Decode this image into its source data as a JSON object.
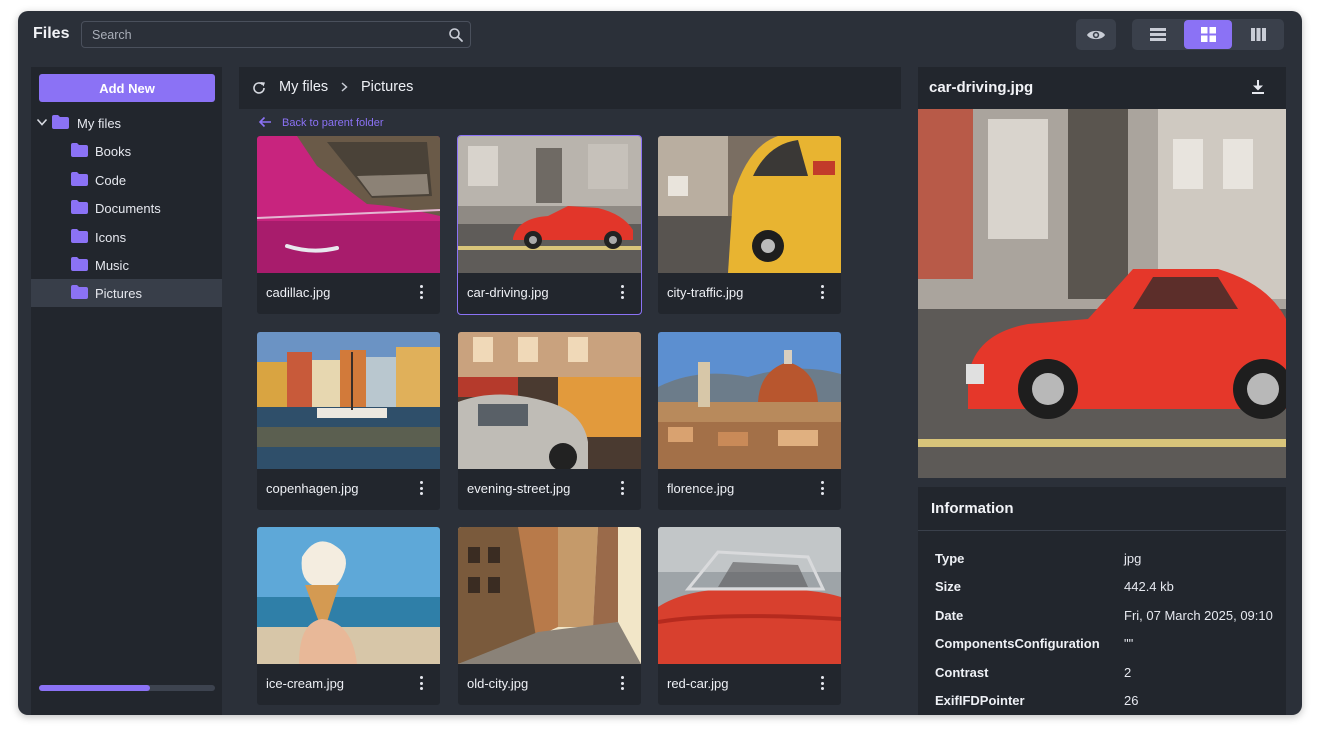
{
  "app": {
    "title": "Files"
  },
  "search": {
    "placeholder": "Search"
  },
  "toolbar": {
    "preview_toggle_icon": "eye-icon",
    "views": [
      {
        "name": "list",
        "icon": "list-view-icon",
        "active": false
      },
      {
        "name": "grid",
        "icon": "grid-view-icon",
        "active": true
      },
      {
        "name": "columns",
        "icon": "columns-view-icon",
        "active": false
      }
    ]
  },
  "sidebar": {
    "add_new_label": "Add New",
    "root": {
      "label": "My files",
      "expanded": true
    },
    "folders": [
      {
        "label": "Books",
        "selected": false
      },
      {
        "label": "Code",
        "selected": false
      },
      {
        "label": "Documents",
        "selected": false
      },
      {
        "label": "Icons",
        "selected": false
      },
      {
        "label": "Music",
        "selected": false
      },
      {
        "label": "Pictures",
        "selected": true
      }
    ],
    "storage_progress": 0.63
  },
  "breadcrumb": {
    "items": [
      "My files",
      "Pictures"
    ]
  },
  "back_link": "Back to parent folder",
  "files": [
    {
      "name": "cadillac.jpg",
      "selected": false
    },
    {
      "name": "car-driving.jpg",
      "selected": true
    },
    {
      "name": "city-traffic.jpg",
      "selected": false
    },
    {
      "name": "copenhagen.jpg",
      "selected": false
    },
    {
      "name": "evening-street.jpg",
      "selected": false
    },
    {
      "name": "florence.jpg",
      "selected": false
    },
    {
      "name": "ice-cream.jpg",
      "selected": false
    },
    {
      "name": "old-city.jpg",
      "selected": false
    },
    {
      "name": "red-car.jpg",
      "selected": false
    }
  ],
  "preview": {
    "title": "car-driving.jpg",
    "info_title": "Information",
    "info": [
      {
        "key": "Type",
        "value": "jpg"
      },
      {
        "key": "Size",
        "value": "442.4 kb"
      },
      {
        "key": "Date",
        "value": "Fri, 07 March 2025, 09:10"
      },
      {
        "key": "ComponentsConfiguration",
        "value": "\"\""
      },
      {
        "key": "Contrast",
        "value": "2"
      },
      {
        "key": "ExifIFDPointer",
        "value": "26"
      }
    ]
  },
  "colors": {
    "accent": "#8b72f5",
    "panel": "#22262d",
    "window": "#2b3039"
  }
}
